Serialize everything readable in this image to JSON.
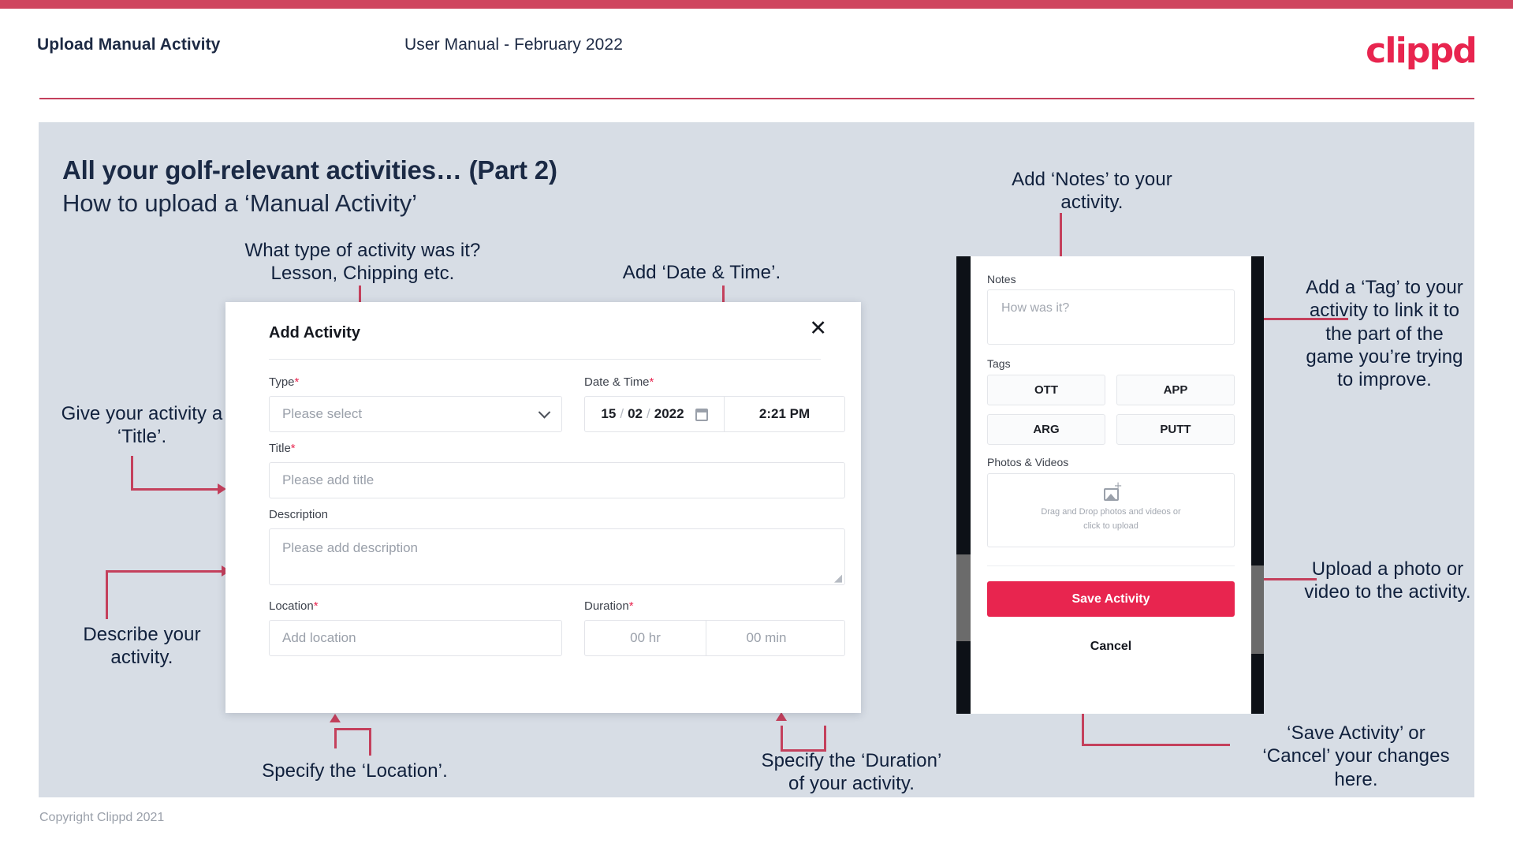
{
  "header": {
    "title": "Upload Manual Activity",
    "subtitle": "User Manual - February 2022",
    "logo": "clippd"
  },
  "slide": {
    "heading": "All your golf-relevant activities… (Part 2)",
    "subheading": "How to upload a ‘Manual Activity’"
  },
  "dialog": {
    "title": "Add Activity",
    "close_icon": "✕",
    "type": {
      "label": "Type",
      "required": "*",
      "placeholder": "Please select"
    },
    "datetime": {
      "label": "Date & Time",
      "required": "*",
      "day": "15",
      "month": "02",
      "year": "2022",
      "sep1": "/",
      "sep2": "/",
      "time": "2:21 PM"
    },
    "title_field": {
      "label": "Title",
      "required": "*",
      "placeholder": "Please add title"
    },
    "description": {
      "label": "Description",
      "placeholder": "Please add description"
    },
    "location": {
      "label": "Location",
      "required": "*",
      "placeholder": "Add location"
    },
    "duration": {
      "label": "Duration",
      "required": "*",
      "hours": "00 hr",
      "minutes": "00 min"
    }
  },
  "phone": {
    "notes": {
      "label": "Notes",
      "placeholder": "How was it?"
    },
    "tags": {
      "label": "Tags",
      "items": [
        "OTT",
        "APP",
        "ARG",
        "PUTT"
      ]
    },
    "photos": {
      "label": "Photos & Videos",
      "drop_line1": "Drag and Drop photos and videos or",
      "drop_line2": "click to upload"
    },
    "save_label": "Save Activity",
    "cancel_label": "Cancel"
  },
  "annotations": {
    "type": "What type of activity was it?\nLesson, Chipping etc.",
    "datetime": "Add ‘Date & Time’.",
    "title": "Give your activity a\n‘Title’.",
    "description": "Describe your\nactivity.",
    "location": "Specify the ‘Location’.",
    "duration": "Specify the ‘Duration’\nof your activity.",
    "notes": "Add ‘Notes’ to your\nactivity.",
    "tags": "Add a ‘Tag’ to your\nactivity to link it to\nthe part of the\ngame you’re trying\nto improve.",
    "upload": "Upload a photo or\nvideo to the activity.",
    "save": "‘Save Activity’ or\n‘Cancel’ your changes\nhere."
  },
  "footer": {
    "copyright": "Copyright Clippd 2021"
  },
  "colors": {
    "brand": "#e8254f",
    "accent_bar": "#cf455f",
    "connector": "#c4405c",
    "slide_bg": "#d7dde5",
    "text_dark": "#1b2a45"
  }
}
